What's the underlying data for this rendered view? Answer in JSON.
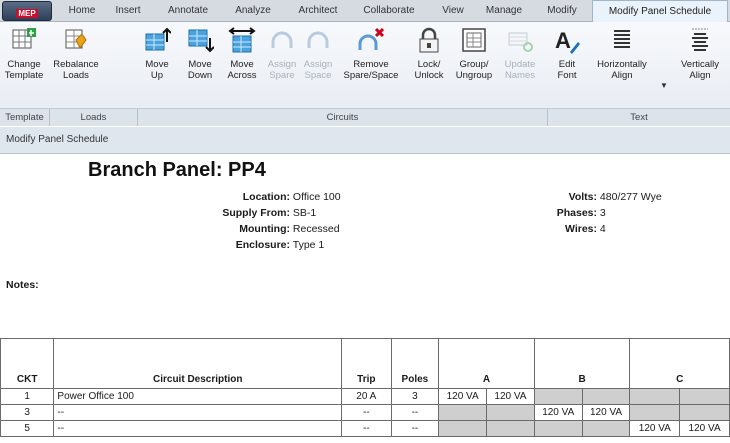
{
  "app": {
    "badge": "MEP"
  },
  "tabs": [
    "Home",
    "Insert",
    "Annotate",
    "Analyze",
    "Architect",
    "Collaborate",
    "View",
    "Manage",
    "Modify",
    "Modify Panel Schedule"
  ],
  "ribbon": {
    "buttons": {
      "change_template": "Change\nTemplate",
      "rebalance_loads": "Rebalance\nLoads",
      "move_up": "Move\nUp",
      "move_down": "Move\nDown",
      "move_across": "Move\nAcross",
      "assign_spare": "Assign\nSpare",
      "assign_space": "Assign\nSpace",
      "remove_spare_space": "Remove\nSpare/Space",
      "lock_unlock": "Lock/\nUnlock",
      "group_ungroup": "Group/\nUngroup",
      "update_names": "Update\nNames",
      "edit_font": "Edit\nFont",
      "horizontally_align": "Horizontally\nAlign",
      "vertically_align": "Vertically\nAlign"
    },
    "groups": {
      "template": "Template",
      "loads": "Loads",
      "circuits": "Circuits",
      "text": "Text"
    }
  },
  "contextbar": {
    "label": "Modify Panel Schedule"
  },
  "panel": {
    "title": "Branch Panel: PP4",
    "location_label": "Location:",
    "location": "Office 100",
    "supply_label": "Supply From:",
    "supply": "SB-1",
    "mounting_label": "Mounting:",
    "mounting": "Recessed",
    "enclosure_label": "Enclosure:",
    "enclosure": "Type 1",
    "volts_label": "Volts:",
    "volts": "480/277 Wye",
    "phases_label": "Phases:",
    "phases": "3",
    "wires_label": "Wires:",
    "wires": "4",
    "notes_label": "Notes:"
  },
  "schedule": {
    "headers": {
      "ckt": "CKT",
      "desc": "Circuit Description",
      "trip": "Trip",
      "poles": "Poles",
      "a": "A",
      "b": "B",
      "c": "C"
    },
    "rows": [
      {
        "ckt": "1",
        "desc": "Power Office 100",
        "trip": "20 A",
        "poles": "3",
        "a1": "120 VA",
        "a2": "120 VA",
        "b1": "",
        "b2": "",
        "c1": "",
        "c2": ""
      },
      {
        "ckt": "3",
        "desc": "--",
        "trip": "--",
        "poles": "--",
        "a1": "",
        "a2": "",
        "b1": "120 VA",
        "b2": "120 VA",
        "c1": "",
        "c2": ""
      },
      {
        "ckt": "5",
        "desc": "--",
        "trip": "--",
        "poles": "--",
        "a1": "",
        "a2": "",
        "b1": "",
        "b2": "",
        "c1": "120 VA",
        "c2": "120 VA"
      }
    ]
  }
}
